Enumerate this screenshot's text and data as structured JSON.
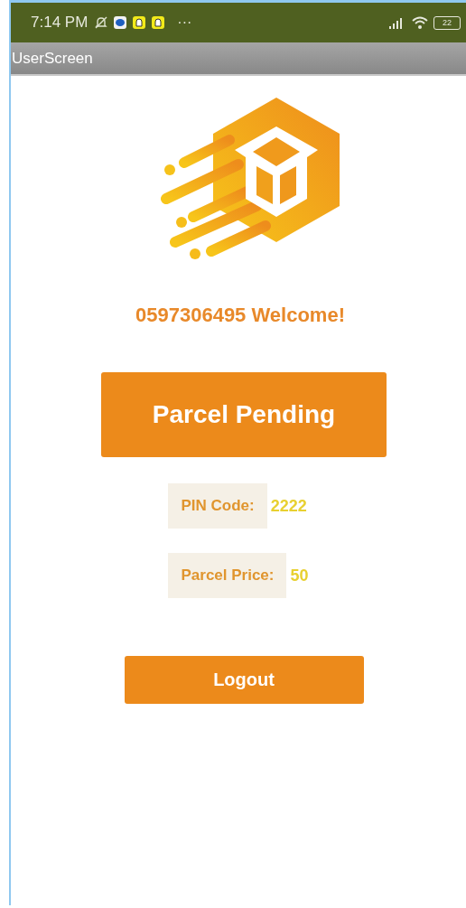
{
  "status_bar": {
    "time": "7:14 PM",
    "more": "···",
    "battery": "22"
  },
  "title_bar": {
    "title": "UserScreen"
  },
  "welcome": "0597306495 Welcome!",
  "status_button": "Parcel Pending",
  "details": [
    {
      "label": "PIN Code:",
      "value": "2222"
    },
    {
      "label": "Parcel Price:",
      "value": "50"
    }
  ],
  "logout_button": "Logout"
}
